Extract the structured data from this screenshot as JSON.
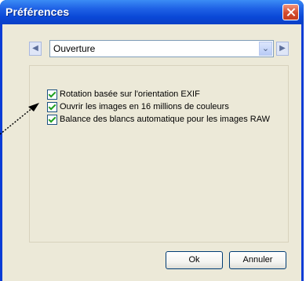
{
  "window": {
    "title": "Préférences"
  },
  "navigator": {
    "selected_page": "Ouverture"
  },
  "options": [
    {
      "label": "Rotation basée sur l'orientation EXIF",
      "checked": true
    },
    {
      "label": "Ouvrir les images en 16 millions de couleurs",
      "checked": true
    },
    {
      "label": "Balance des blancs automatique pour les images RAW",
      "checked": true
    }
  ],
  "buttons": {
    "ok_label": "Ok",
    "cancel_label": "Annuler"
  },
  "colors": {
    "title_bar": "#0a48d7",
    "dialog_background": "#ece9d8",
    "check_mark": "#21a121",
    "close_button": "#d24b2e"
  },
  "icons": {
    "previous": "left-arrow-icon",
    "next": "right-arrow-icon",
    "dropdown": "chevron-down-icon",
    "close": "close-icon"
  }
}
